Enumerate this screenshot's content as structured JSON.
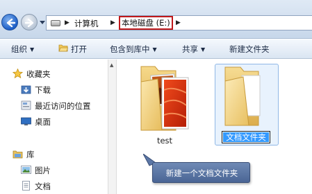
{
  "address_bar": {
    "crumbs": [
      "计算机",
      "本地磁盘 (E:)"
    ]
  },
  "toolbar": {
    "organize_label": "组织",
    "open_label": "打开",
    "include_label": "包含到库中",
    "share_label": "共享",
    "new_folder_label": "新建文件夹"
  },
  "nav_pane": {
    "favorites_label": "收藏夹",
    "favorites_items": [
      "下载",
      "最近访问的位置",
      "桌面"
    ],
    "libraries_label": "库",
    "libraries_items": [
      "图片",
      "文档"
    ]
  },
  "content": {
    "items": [
      {
        "name": "test"
      },
      {
        "name": "文档文件夹",
        "renaming": true
      }
    ]
  },
  "callout": {
    "text": "新建一个文档文件夹"
  },
  "colors": {
    "highlight_border": "#c0181a",
    "selection": "#3399ff",
    "callout_bg": "#5a75a5"
  }
}
